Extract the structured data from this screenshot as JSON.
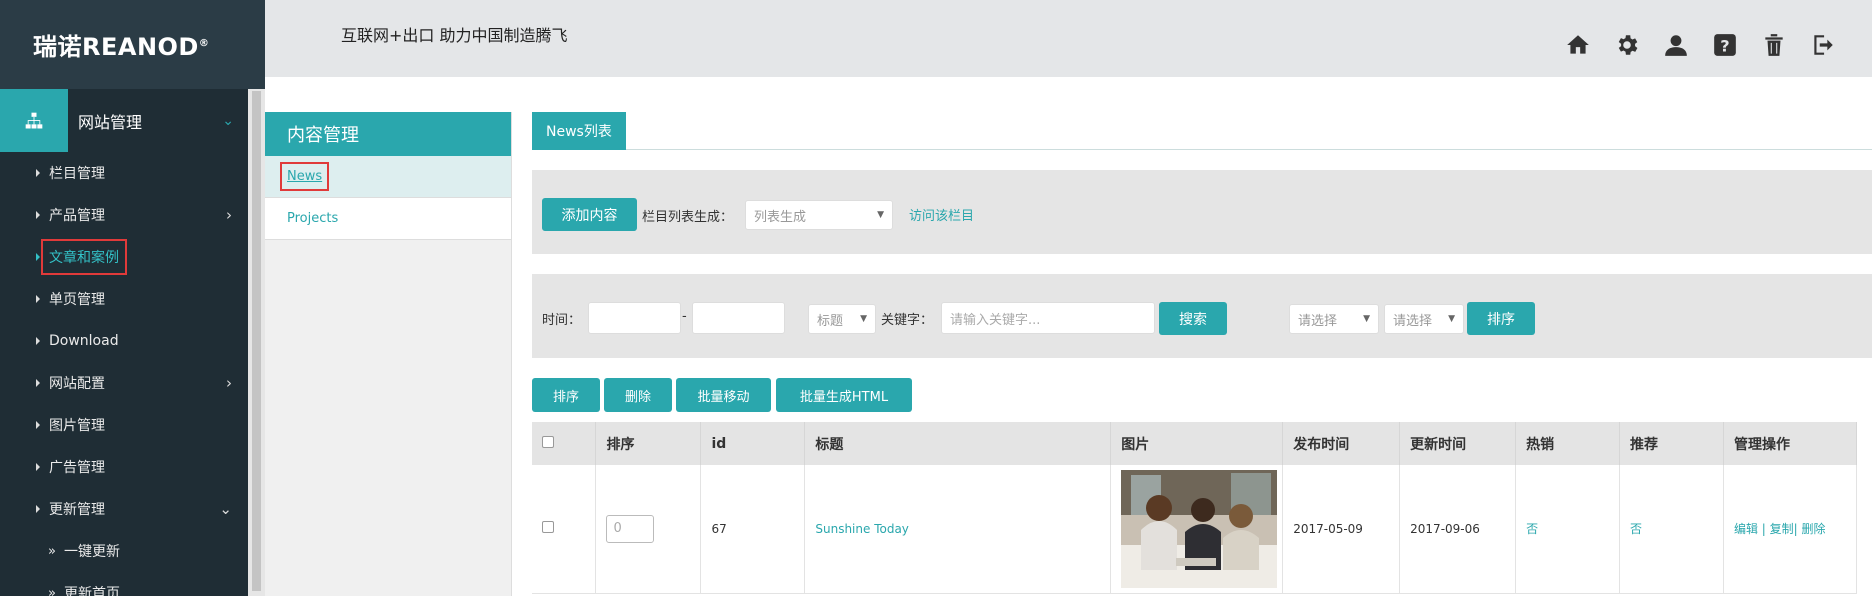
{
  "logo": {
    "text": "瑞诺REANOD",
    "mark": "®"
  },
  "header": {
    "slogan": "互联网+出口  助力中国制造腾飞"
  },
  "top_icons": [
    "home-icon",
    "gear-icon",
    "user-icon",
    "help-icon",
    "trash-icon",
    "logout-icon"
  ],
  "sidebar": {
    "head": "网站管理",
    "items": [
      {
        "label": "栏目管理",
        "chevron": false
      },
      {
        "label": "产品管理",
        "chevron": true
      },
      {
        "label": "文章和案例",
        "chevron": false,
        "active": true
      },
      {
        "label": "单页管理",
        "chevron": false
      },
      {
        "label": "Download",
        "chevron": false
      },
      {
        "label": "网站配置",
        "chevron": true
      },
      {
        "label": "图片管理",
        "chevron": false
      },
      {
        "label": "广告管理",
        "chevron": false
      },
      {
        "label": "更新管理",
        "chevron": true,
        "expanded": true
      }
    ],
    "subitems": [
      "一键更新",
      "更新首页"
    ]
  },
  "content_panel": {
    "title": "内容管理",
    "items": [
      "News",
      "Projects"
    ]
  },
  "tab": "News列表",
  "toolbar1": {
    "add_button": "添加内容",
    "gen_label": "栏目列表生成：",
    "gen_select": "列表生成",
    "visit_link": "访问该栏目"
  },
  "toolbar2": {
    "time_label": "时间：",
    "dash": "-",
    "field_select": "标题",
    "keyword_label": "关键字：",
    "keyword_placeholder": "请输入关键字...",
    "search_button": "搜索",
    "sort_select1": "请选择",
    "sort_select2": "请选择",
    "sort_button": "排序"
  },
  "actions": [
    "排序",
    "删除",
    "批量移动",
    "批量生成HTML"
  ],
  "table": {
    "headers": [
      "",
      "排序",
      "id",
      "标题",
      "图片",
      "发布时间",
      "更新时间",
      "热销",
      "推荐",
      "管理操作"
    ],
    "rows": [
      {
        "order": "0",
        "id": "67",
        "title": "Sunshine Today",
        "published": "2017-05-09",
        "updated": "2017-09-06",
        "hot": "否",
        "recommend": "否",
        "ops": "编辑 | 复制| 删除"
      }
    ]
  },
  "colors": {
    "accent": "#2aa7ad",
    "sidebar_bg": "#1f2d35",
    "highlight": "#e03a3a"
  }
}
